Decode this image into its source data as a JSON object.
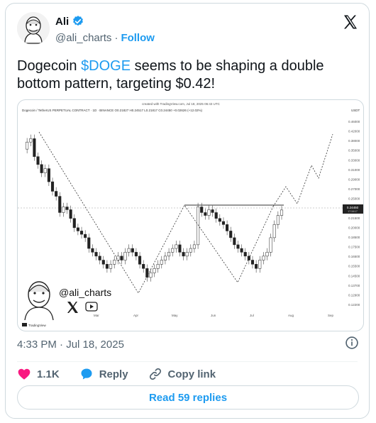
{
  "author": {
    "name": "Ali",
    "handle": "@ali_charts",
    "separator": "·",
    "follow_label": "Follow"
  },
  "tweet": {
    "text_prefix": "Dogecoin ",
    "cashtag": "$DOGE",
    "text_suffix": " seems to be shaping a double bottom pattern, targeting $0.42!",
    "timestamp": "4:33 PM · Jul 18, 2025"
  },
  "actions": {
    "like_count": "1.1K",
    "reply_label": "Reply",
    "copy_label": "Copy link"
  },
  "read_replies_label": "Read 59 replies",
  "colors": {
    "accent": "#1d9bf0",
    "like": "#f91880",
    "muted": "#536471"
  },
  "media": {
    "created_with": "created with TradingView.com, Jul 18, 2025 06:43 UTC",
    "symbol_line": "Dogecoin / TetherUS PERPETUAL CONTRACT · 1D · BINANCE  O0.21827  H0.24517  L0.21817  C0.24450  +0.02626 (+12.02%)",
    "currency": "USDT",
    "watermark_handle": "@ali_charts",
    "tradingview_brand": "TradingView",
    "price_marker": "0.24450",
    "price_marker_sub": "17:16:17",
    "chart_data": {
      "type": "line",
      "title": "Dogecoin / TetherUS PERPETUAL CONTRACT · 1D · BINANCE",
      "x_labels": [
        "Mar",
        "Apr",
        "May",
        "Jun",
        "Jul",
        "Aug",
        "Sep"
      ],
      "y_ticks": [
        "0.46000",
        "0.42000",
        "0.38000",
        "0.35000",
        "0.33000",
        "0.31000",
        "0.29000",
        "0.27000",
        "0.25000",
        "0.23000",
        "0.21500",
        "0.20000",
        "0.18500",
        "0.17500",
        "0.16500",
        "0.15500",
        "0.14500",
        "0.13700",
        "0.12900",
        "0.12200"
      ],
      "price_series": [
        0.38,
        0.4,
        0.41,
        0.36,
        0.34,
        0.32,
        0.33,
        0.3,
        0.28,
        0.27,
        0.24,
        0.25,
        0.245,
        0.23,
        0.215,
        0.21,
        0.205,
        0.2,
        0.185,
        0.18,
        0.175,
        0.17,
        0.165,
        0.16,
        0.165,
        0.17,
        0.175,
        0.17,
        0.18,
        0.185,
        0.18,
        0.175,
        0.165,
        0.16,
        0.15,
        0.155,
        0.16,
        0.165,
        0.17,
        0.175,
        0.18,
        0.185,
        0.19,
        0.18,
        0.175,
        0.18,
        0.185,
        0.19,
        0.25,
        0.24,
        0.235,
        0.245,
        0.24,
        0.23,
        0.225,
        0.22,
        0.21,
        0.2,
        0.19,
        0.185,
        0.18,
        0.175,
        0.17,
        0.165,
        0.16,
        0.17,
        0.175,
        0.18,
        0.2,
        0.22,
        0.235,
        0.2445
      ],
      "resistance_level": 0.25,
      "projection": [
        0.2445,
        0.28,
        0.25,
        0.33,
        0.3,
        0.42
      ],
      "legend": []
    }
  }
}
